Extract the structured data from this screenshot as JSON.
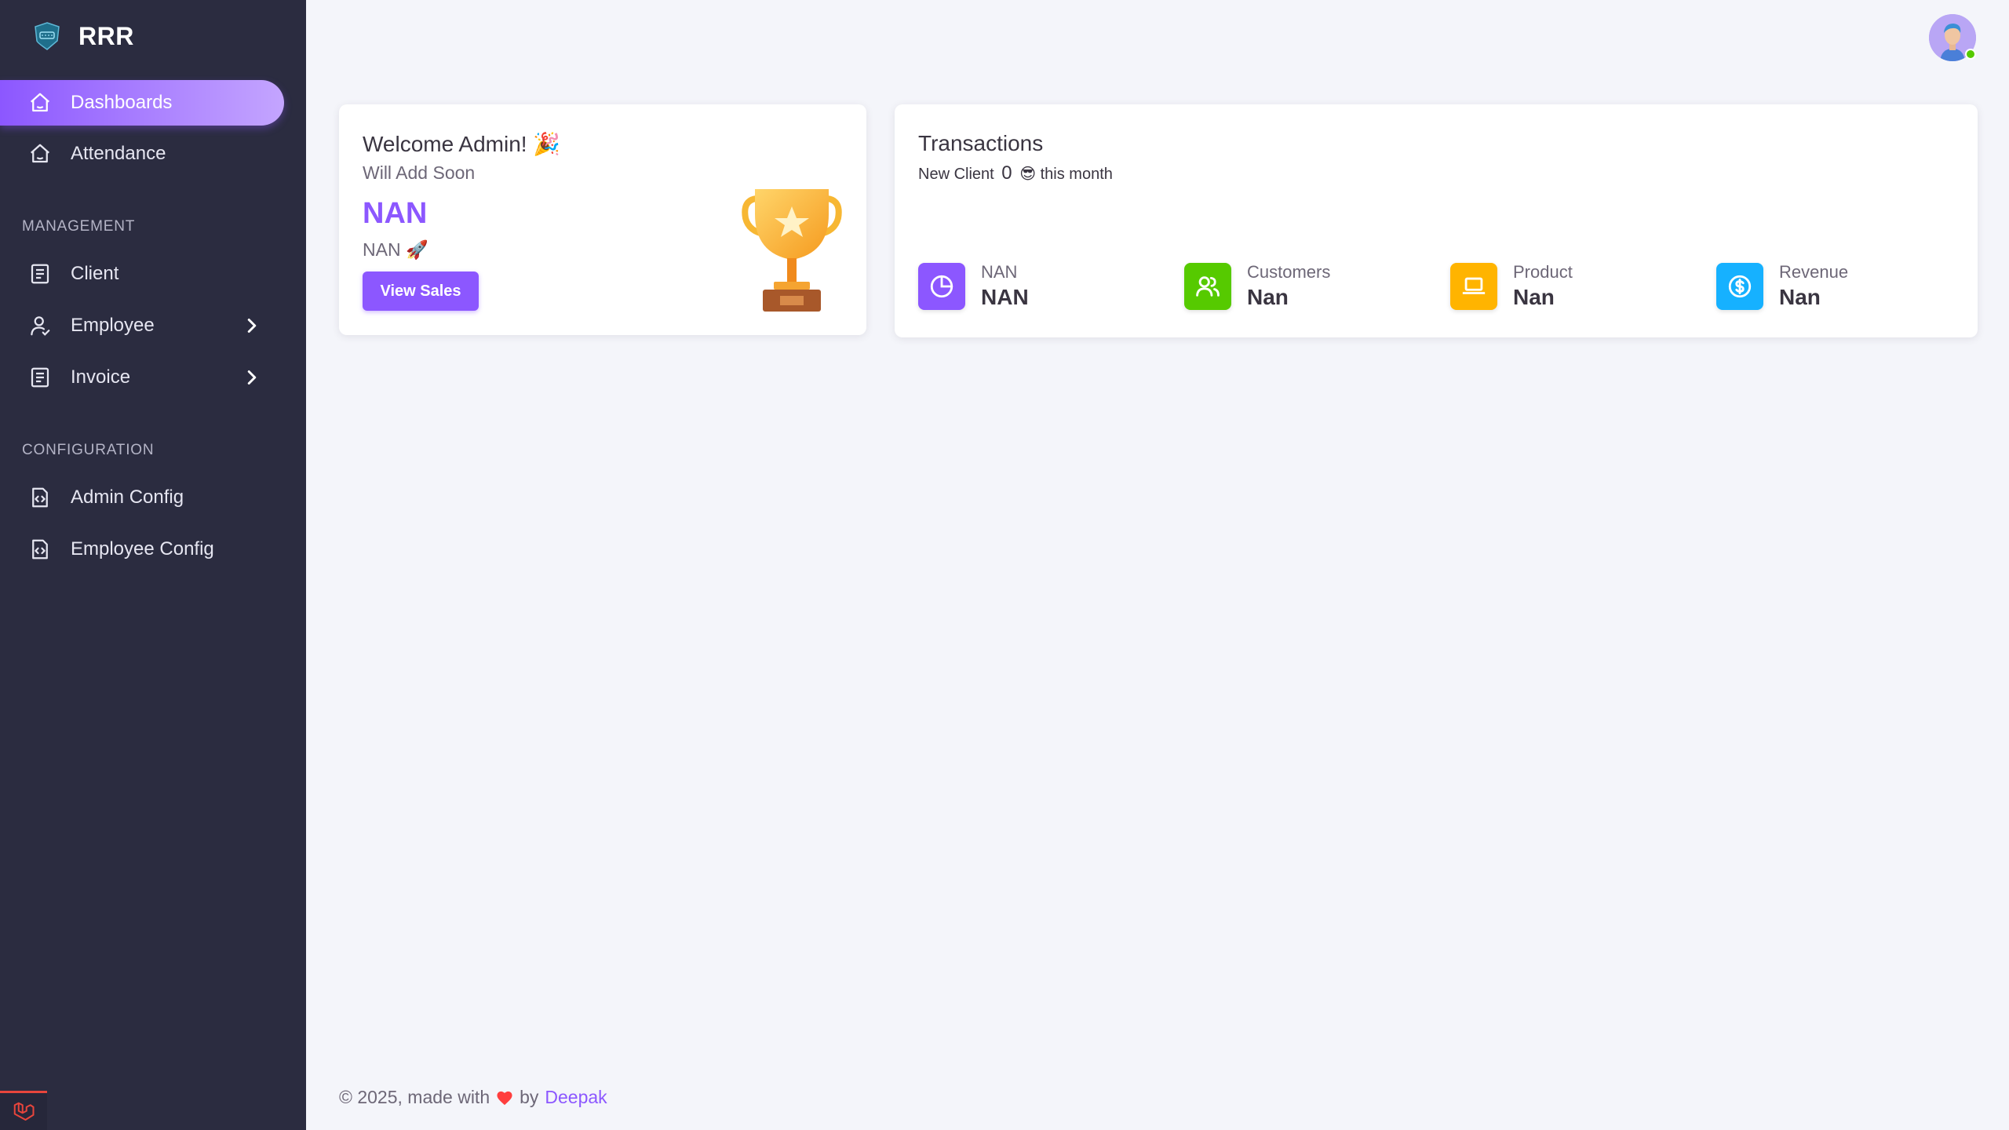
{
  "brand": {
    "name": "RRR"
  },
  "sidebar": {
    "items": [
      {
        "label": "Dashboards",
        "icon": "home-icon",
        "active": true
      },
      {
        "label": "Attendance",
        "icon": "home-icon"
      }
    ],
    "sections": [
      {
        "label": "MANAGEMENT",
        "items": [
          {
            "label": "Client",
            "icon": "document-icon"
          },
          {
            "label": "Employee",
            "icon": "user-icon",
            "has_submenu": true
          },
          {
            "label": "Invoice",
            "icon": "document-icon",
            "has_submenu": true
          }
        ]
      },
      {
        "label": "CONFIGURATION",
        "items": [
          {
            "label": "Admin Config",
            "icon": "code-file-icon"
          },
          {
            "label": "Employee Config",
            "icon": "code-file-icon"
          }
        ]
      }
    ]
  },
  "welcome_card": {
    "title": "Welcome Admin! 🎉",
    "subtitle": "Will Add Soon",
    "value": "NAN",
    "secondary": "NAN 🚀",
    "button_label": "View Sales"
  },
  "transactions_card": {
    "title": "Transactions",
    "sub_prefix": "New Client",
    "sub_count": "0",
    "sub_emoji": "😎",
    "sub_suffix": "this month",
    "stats": [
      {
        "label": "NAN",
        "value": "NAN",
        "icon": "pie-chart-icon",
        "color": "#8c57ff"
      },
      {
        "label": "Customers",
        "value": "Nan",
        "icon": "users-icon",
        "color": "#56ca00"
      },
      {
        "label": "Product",
        "value": "Nan",
        "icon": "laptop-icon",
        "color": "#ffb400"
      },
      {
        "label": "Revenue",
        "value": "Nan",
        "icon": "dollar-circle-icon",
        "color": "#16b1ff"
      }
    ]
  },
  "footer": {
    "prefix": "© 2025, made with",
    "by": "by",
    "author": "Deepak"
  },
  "colors": {
    "primary": "#8c57ff",
    "sidebar_bg": "#2b2c40",
    "page_bg": "#f4f5fa",
    "success": "#56ca00",
    "warning": "#ffb400",
    "info": "#16b1ff"
  }
}
